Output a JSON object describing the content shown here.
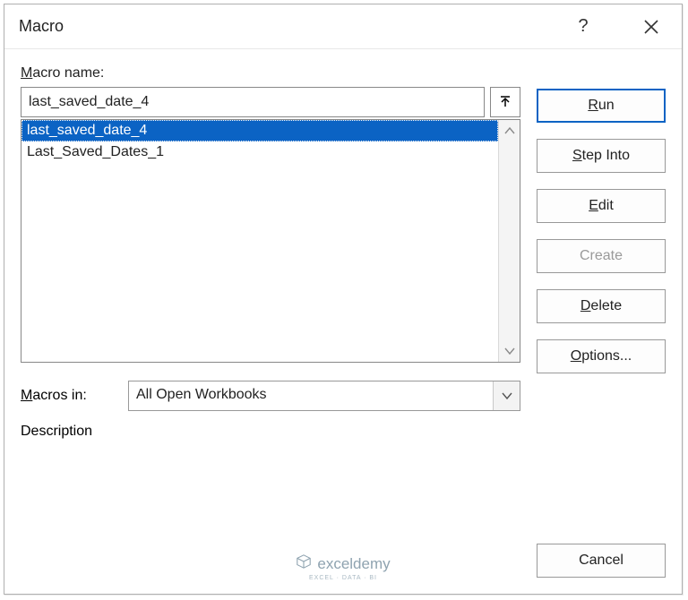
{
  "title": "Macro",
  "labels": {
    "macro_name": "acro name:",
    "macro_name_u": "M",
    "macros_in": "acros in:",
    "macros_in_u": "M",
    "description": "Description"
  },
  "macro_name_value": "last_saved_date_4",
  "macro_list": [
    {
      "text": "last_saved_date_4",
      "selected": true
    },
    {
      "text": "Last_Saved_Dates_1",
      "selected": false
    }
  ],
  "macros_in_value": "All Open Workbooks",
  "buttons": {
    "run": "un",
    "run_u": "R",
    "step_into": "tep Into",
    "step_into_u": "S",
    "edit": "dit",
    "edit_u": "E",
    "create": "Create",
    "delete": "elete",
    "delete_u": "D",
    "options": "ptions...",
    "options_u": "O",
    "cancel": "Cancel"
  },
  "watermark": {
    "brand": "exceldemy",
    "sub": "EXCEL · DATA · BI"
  }
}
